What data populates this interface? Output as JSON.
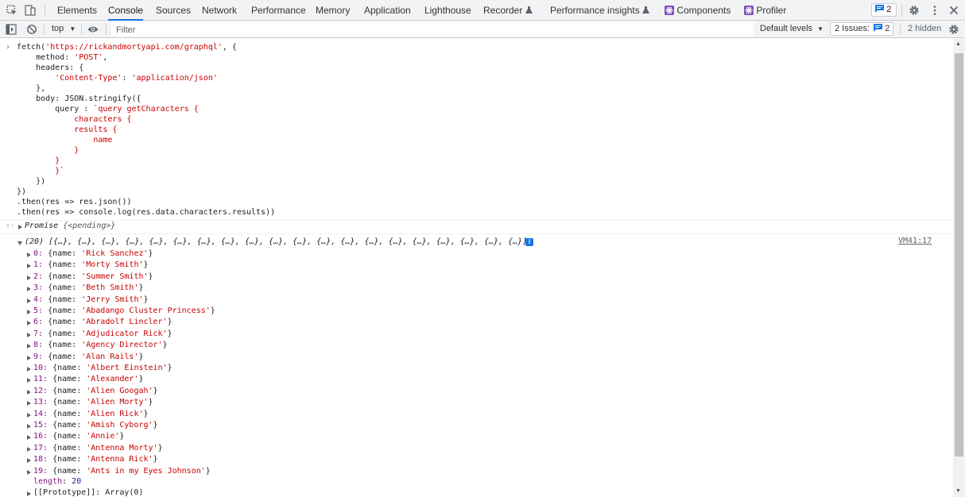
{
  "tabs": [
    {
      "label": "Elements"
    },
    {
      "label": "Console"
    },
    {
      "label": "Sources"
    },
    {
      "label": "Network"
    },
    {
      "label": "Performance"
    },
    {
      "label": "Memory"
    },
    {
      "label": "Application"
    },
    {
      "label": "Lighthouse"
    },
    {
      "label": "Recorder"
    },
    {
      "label": "Performance insights"
    },
    {
      "label": "Components"
    },
    {
      "label": "Profiler"
    }
  ],
  "header": {
    "issues_count": "2"
  },
  "toolbar": {
    "context": "top",
    "filter_placeholder": "Filter",
    "levels": "Default levels",
    "issues_label": "2 Issues:",
    "issues_count": "2",
    "hidden": "2 hidden"
  },
  "code": {
    "l1a": "fetch(",
    "l1b": "'https://rickandmortyapi.com/graphql'",
    "l1c": ", {",
    "l2a": "    method: ",
    "l2b": "'POST'",
    "l2c": ",",
    "l3": "    headers: {",
    "l4a": "        ",
    "l4b": "'Content-Type'",
    "l4c": ": ",
    "l4d": "'application/json'",
    "l5": "    },",
    "l6": "    body: JSON.stringify({",
    "l7a": "        query : ",
    "l7b": "`query getCharacters {",
    "l8": "            characters {",
    "l9": "            results {",
    "l10": "                name",
    "l11": "            }",
    "l12": "        }",
    "l13": "        }`",
    "l14": "    })",
    "l15": "})",
    "l16": ".then(res => res.json())",
    "l17": ".then(res => console.log(res.data.characters.results))"
  },
  "promise": {
    "label": "Promise",
    "state": "{<pending>}"
  },
  "array": {
    "summary_count": "(20) ",
    "summary": "[{…}, {…}, {…}, {…}, {…}, {…}, {…}, {…}, {…}, {…}, {…}, {…}, {…}, {…}, {…}, {…}, {…}, {…}, {…}, {…}]",
    "source": "VM41:17",
    "items": [
      {
        "index": "0: ",
        "name": "'Rick Sanchez'"
      },
      {
        "index": "1: ",
        "name": "'Morty Smith'"
      },
      {
        "index": "2: ",
        "name": "'Summer Smith'"
      },
      {
        "index": "3: ",
        "name": "'Beth Smith'"
      },
      {
        "index": "4: ",
        "name": "'Jerry Smith'"
      },
      {
        "index": "5: ",
        "name": "'Abadango Cluster Princess'"
      },
      {
        "index": "6: ",
        "name": "'Abradolf Lincler'"
      },
      {
        "index": "7: ",
        "name": "'Adjudicator Rick'"
      },
      {
        "index": "8: ",
        "name": "'Agency Director'"
      },
      {
        "index": "9: ",
        "name": "'Alan Rails'"
      },
      {
        "index": "10: ",
        "name": "'Albert Einstein'"
      },
      {
        "index": "11: ",
        "name": "'Alexander'"
      },
      {
        "index": "12: ",
        "name": "'Alien Googah'"
      },
      {
        "index": "13: ",
        "name": "'Alien Morty'"
      },
      {
        "index": "14: ",
        "name": "'Alien Rick'"
      },
      {
        "index": "15: ",
        "name": "'Amish Cyborg'"
      },
      {
        "index": "16: ",
        "name": "'Annie'"
      },
      {
        "index": "17: ",
        "name": "'Antenna Morty'"
      },
      {
        "index": "18: ",
        "name": "'Antenna Rick'"
      },
      {
        "index": "19: ",
        "name": "'Ants in my Eyes Johnson'"
      }
    ],
    "object_prefix": "{name: ",
    "object_suffix": "}",
    "length_key": "length",
    "length_value": "20",
    "prototype": "[[Prototype]]: Array(0)"
  }
}
